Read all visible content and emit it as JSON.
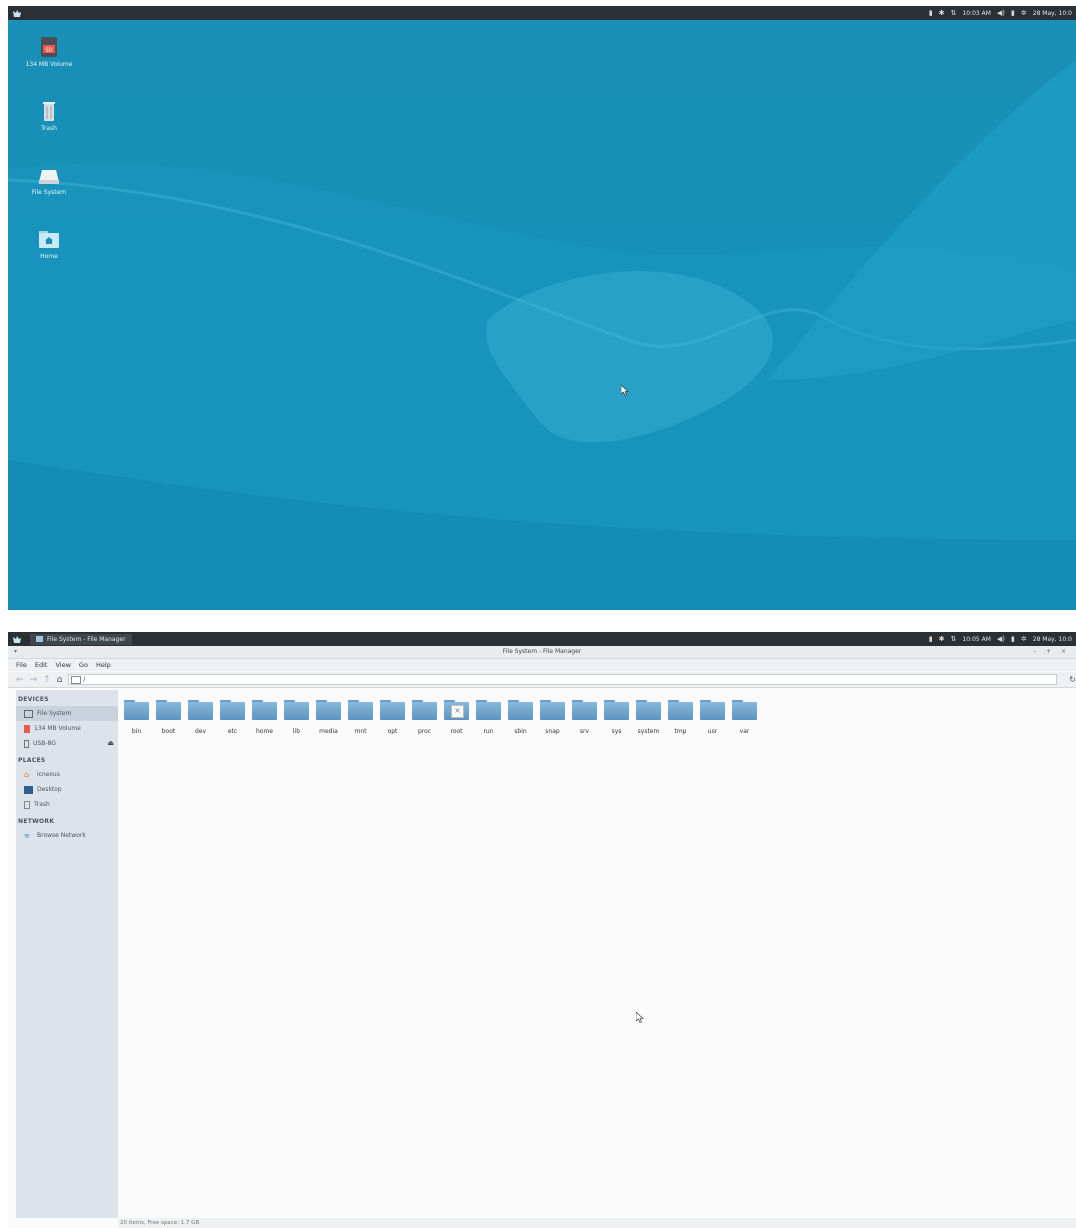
{
  "desktop": {
    "panel": {
      "clock": "10:03 AM",
      "date": "28 May, 10:0"
    },
    "icons": [
      {
        "label": "134 MB Volume",
        "badge": "SD"
      },
      {
        "label": "Trash"
      },
      {
        "label": "File System"
      },
      {
        "label": "Home"
      }
    ]
  },
  "filemanager": {
    "panel": {
      "task_label": "File System - File Manager",
      "clock": "10:05 AM",
      "date": "28 May, 10:0"
    },
    "window_title": "File System - File Manager",
    "window_buttons": "– + ×",
    "menu": [
      "File",
      "Edit",
      "View",
      "Go",
      "Help"
    ],
    "path": "/",
    "sidebar": {
      "devices_label": "DEVICES",
      "devices": [
        {
          "label": "File System"
        },
        {
          "label": "134 MB Volume"
        },
        {
          "label": "USB-8G"
        }
      ],
      "places_label": "PLACES",
      "places": [
        {
          "label": "icnexus"
        },
        {
          "label": "Desktop"
        },
        {
          "label": "Trash"
        }
      ],
      "network_label": "NETWORK",
      "network": [
        {
          "label": "Browse Network"
        }
      ]
    },
    "folders": [
      {
        "name": "bin"
      },
      {
        "name": "boot"
      },
      {
        "name": "dev"
      },
      {
        "name": "etc"
      },
      {
        "name": "home"
      },
      {
        "name": "lib"
      },
      {
        "name": "media"
      },
      {
        "name": "mnt"
      },
      {
        "name": "opt"
      },
      {
        "name": "proc"
      },
      {
        "name": "root",
        "locked": true
      },
      {
        "name": "run"
      },
      {
        "name": "sbin"
      },
      {
        "name": "snap"
      },
      {
        "name": "srv"
      },
      {
        "name": "sys"
      },
      {
        "name": "system"
      },
      {
        "name": "tmp"
      },
      {
        "name": "usr"
      },
      {
        "name": "var"
      }
    ],
    "status": "20 items, Free space: 1.7 GB"
  }
}
